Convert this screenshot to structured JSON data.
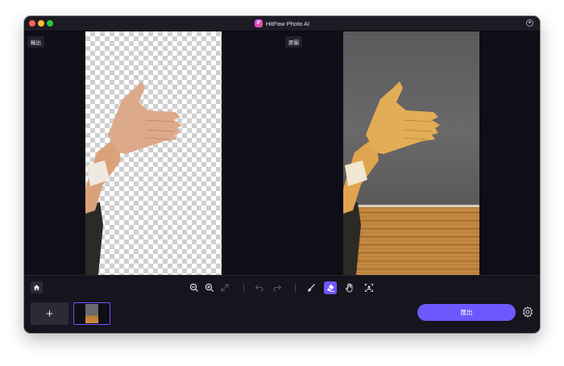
{
  "app": {
    "title": "HitPaw Photo AI",
    "logo_letter": "P"
  },
  "panels": {
    "output_label": "輸出",
    "original_label": "原圖"
  },
  "toolbar": {
    "tools": [
      "zoom-out",
      "zoom-in",
      "fit-screen",
      "undo",
      "redo",
      "brush",
      "eraser",
      "hand",
      "crop-select"
    ],
    "active_tool": "eraser",
    "add_label": "+",
    "export_label": "匯出"
  },
  "colors": {
    "accent": "#6e57ff",
    "window_bg": "#0f0d16",
    "toolbar_bg": "#16141d"
  }
}
